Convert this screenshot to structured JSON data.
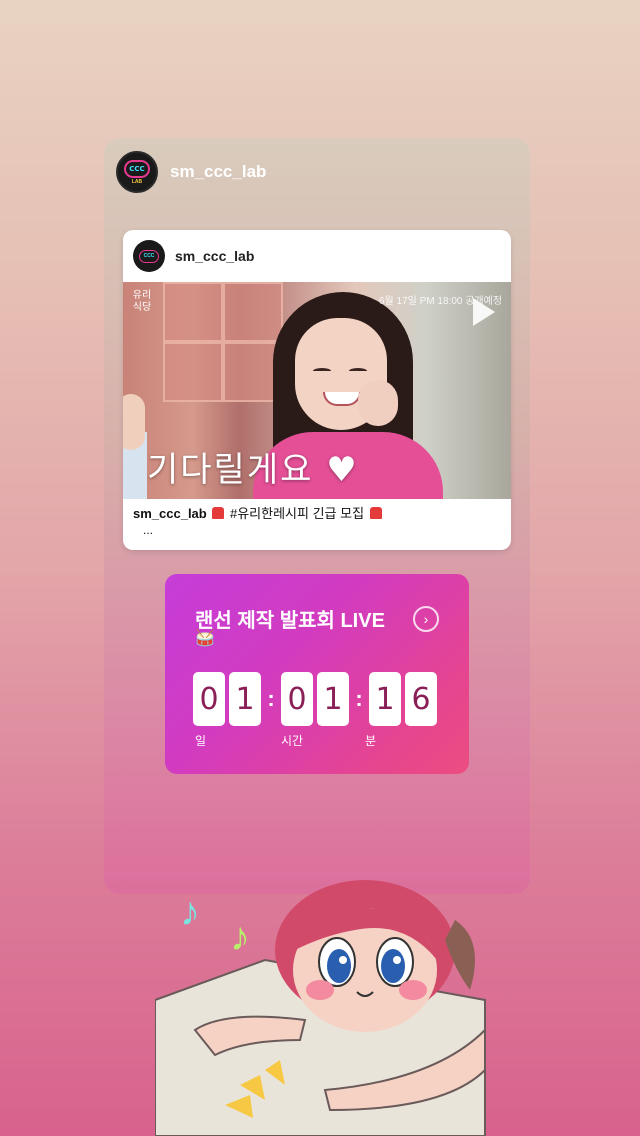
{
  "story": {
    "username": "sm_ccc_lab",
    "avatar_logo": "CCC",
    "avatar_sub": "LAB"
  },
  "post": {
    "username": "sm_ccc_lab",
    "media_overlay_date": "6월 17일 PM 18:00 공개예정",
    "media_caption_overlay": "기다릴게요",
    "media_logo_text": "유리\n식당",
    "caption_username": "sm_ccc_lab",
    "caption_text": "#유리한레시피 긴급 모집",
    "caption_more": "..."
  },
  "countdown": {
    "title": "랜선 제작 발표회 LIVE",
    "emoji": "🥁",
    "digits": [
      "0",
      "1",
      "0",
      "1",
      "1",
      "6"
    ],
    "labels": {
      "days": "일",
      "hours": "시간",
      "minutes": "분"
    },
    "gradient_start": "#c53dd9",
    "gradient_end": "#ec4d80"
  },
  "icons": {
    "play": "play-icon",
    "arrow": "chevron-right-icon",
    "music_notes": [
      "music-note-icon-cyan",
      "music-note-icon-green"
    ]
  }
}
